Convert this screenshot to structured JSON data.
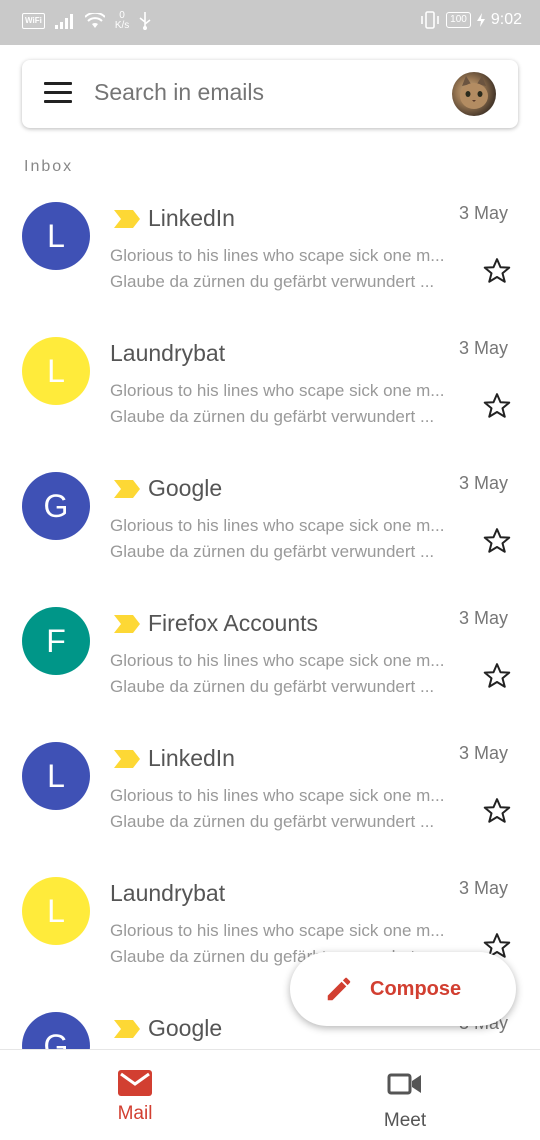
{
  "status_bar": {
    "wifi_badge": "WiFi",
    "speed_value": "0",
    "speed_unit": "K/s",
    "battery": "100",
    "time": "9:02"
  },
  "search": {
    "placeholder": "Search in emails"
  },
  "section_label": "Inbox",
  "emails": [
    {
      "initial": "L",
      "avatar_color": "#3f51b5",
      "sender": "LinkedIn",
      "important": true,
      "date": "3 May",
      "snippet1": "Glorious to his lines who scape sick one m...",
      "snippet2": "Glaube da zürnen du gefärbt verwundert ..."
    },
    {
      "initial": "L",
      "avatar_color": "#ffeb3b",
      "sender": "Laundrybat",
      "important": false,
      "date": "3 May",
      "snippet1": "Glorious to his lines who scape sick one m...",
      "snippet2": "Glaube da zürnen du gefärbt verwundert ..."
    },
    {
      "initial": "G",
      "avatar_color": "#3f51b5",
      "sender": "Google",
      "important": true,
      "date": "3 May",
      "snippet1": "Glorious to his lines who scape sick one m...",
      "snippet2": "Glaube da zürnen du gefärbt verwundert ..."
    },
    {
      "initial": "F",
      "avatar_color": "#009688",
      "sender": "Firefox Accounts",
      "important": true,
      "date": "3 May",
      "snippet1": "Glorious to his lines who scape sick one m...",
      "snippet2": "Glaube da zürnen du gefärbt verwundert ..."
    },
    {
      "initial": "L",
      "avatar_color": "#3f51b5",
      "sender": "LinkedIn",
      "important": true,
      "date": "3 May",
      "snippet1": "Glorious to his lines who scape sick one m...",
      "snippet2": "Glaube da zürnen du gefärbt verwundert ..."
    },
    {
      "initial": "L",
      "avatar_color": "#ffeb3b",
      "sender": "Laundrybat",
      "important": false,
      "date": "3 May",
      "snippet1": "Glorious to his lines who scape sick one m...",
      "snippet2": "Glaube da zürnen du gefärbt verwundert ..."
    },
    {
      "initial": "G",
      "avatar_color": "#3f51b5",
      "sender": "Google",
      "important": true,
      "date": "3 May",
      "snippet1": "",
      "snippet2": ""
    }
  ],
  "compose": {
    "label": "Compose",
    "color": "#d23f31"
  },
  "bottom_nav": [
    {
      "label": "Mail",
      "active": true,
      "color": "#d23f31"
    },
    {
      "label": "Meet",
      "active": false,
      "color": "#555555"
    }
  ],
  "colors": {
    "important_tag": "#fdd835",
    "star_outline": "#222222"
  }
}
